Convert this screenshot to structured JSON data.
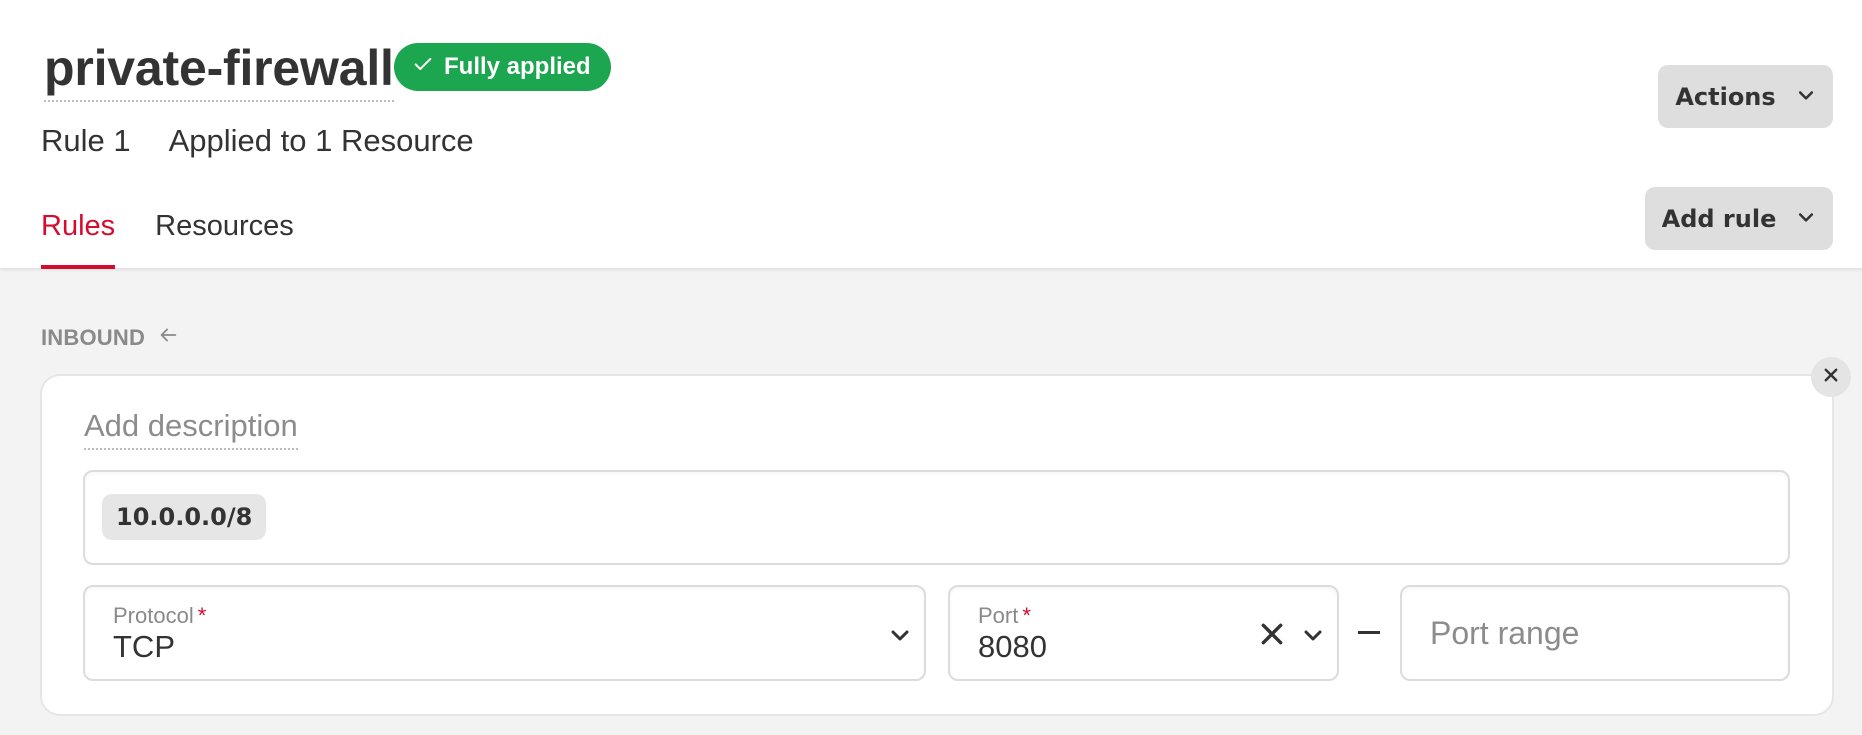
{
  "header": {
    "title": "private-firewall",
    "status_badge": "Fully applied",
    "rule_count": "Rule 1",
    "applied_to": "Applied to 1 Resource",
    "actions_label": "Actions",
    "add_rule_label": "Add rule",
    "tabs": [
      {
        "label": "Rules",
        "active": true
      },
      {
        "label": "Resources",
        "active": false
      }
    ]
  },
  "colors": {
    "accent": "#d50c2d",
    "status_success": "#1ba64f",
    "background": "#f3f3f3"
  },
  "inbound": {
    "section_label": "INBOUND",
    "section_icon": "arrow-left-icon",
    "rules": [
      {
        "description_placeholder": "Add description",
        "sources": [
          "10.0.0.0/8"
        ],
        "protocol_label": "Protocol",
        "protocol_value": "TCP",
        "port_label": "Port",
        "port_value": "8080",
        "required_marker": "*",
        "port_range_placeholder": "Port range",
        "port_range_value": ""
      }
    ]
  }
}
